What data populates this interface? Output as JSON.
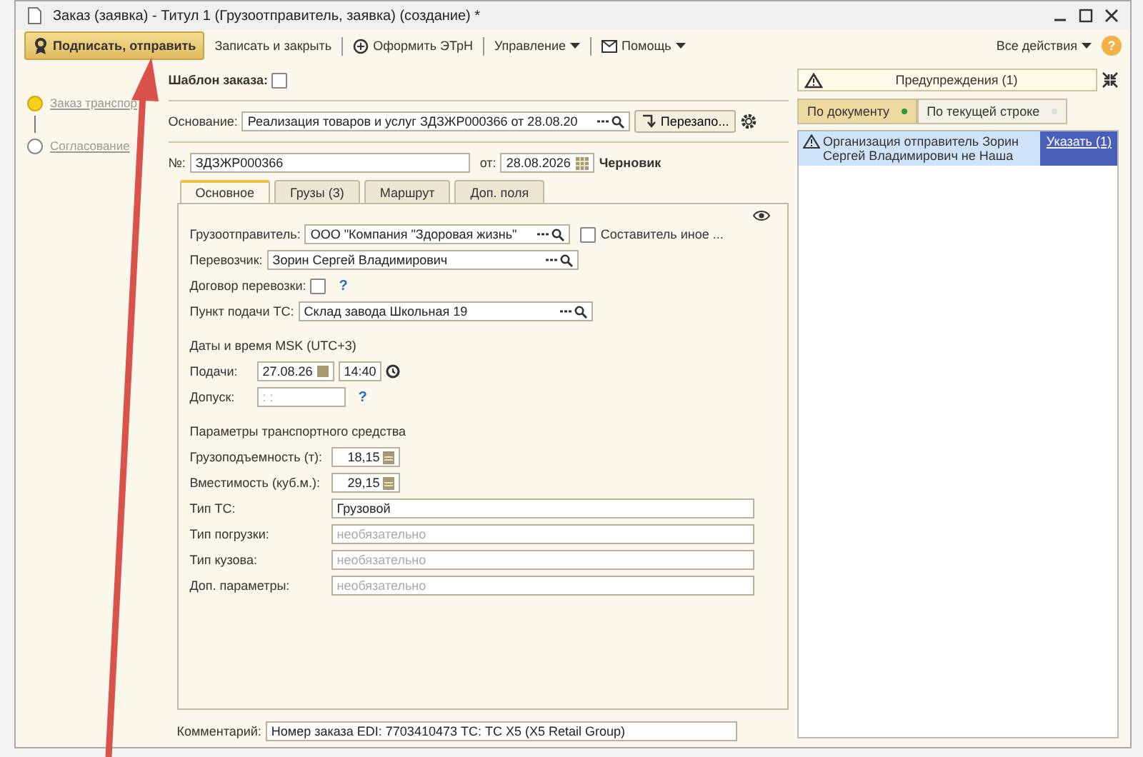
{
  "window": {
    "title": "Заказ (заявка) - Титул 1 (Грузоотправитель, заявка) (создание) *"
  },
  "toolbar": {
    "buttons": [
      {
        "label": "Подписать, отправить",
        "kind": "primary"
      },
      {
        "label": "Записать и закрыть",
        "kind": "plain"
      },
      {
        "label": "Оформить ЭТрН",
        "kind": "doc"
      },
      {
        "label": "Управление",
        "kind": "menu"
      },
      {
        "label": "Помощь",
        "kind": "mail"
      }
    ],
    "all_actions": "Все действия",
    "help": "?"
  },
  "steps": [
    {
      "label": "Заказ транспор",
      "selected": true
    },
    {
      "label": "Согласование",
      "selected": false
    }
  ],
  "form": {
    "template": {
      "label": "Шаблон заказа:",
      "checked": false
    },
    "basis": {
      "label": "Основание:",
      "value": "Реализация товаров и услуг ЗДЗЖР000366 от 28.08.20",
      "button": "Перезапо..."
    },
    "number": {
      "label": "№:",
      "value": "ЗДЗЖР000366",
      "date_label": "от:",
      "date": "28.08.2026",
      "status": "Черновик"
    },
    "tabs": [
      {
        "label": "Основное",
        "selected": true
      },
      {
        "label": "Грузы (3)",
        "selected": false
      },
      {
        "label": "Маршрут",
        "selected": false
      },
      {
        "label": "Доп. поля",
        "selected": false
      }
    ],
    "fields": [
      {
        "kind": "ref",
        "label": "Грузоотправитель:",
        "value": "ООО \"Компания \"Здоровая жизнь\"",
        "extra": {
          "label": "Составитель иное ...",
          "checked": false
        }
      },
      {
        "kind": "ref",
        "label": "Перевозчик:",
        "value": "Зорин Сергей Владимирович"
      },
      {
        "kind": "check",
        "label": "Договор перевозки:",
        "checked": false,
        "help": "?"
      },
      {
        "kind": "ref",
        "label": "Пункт подачи ТС:",
        "value": "Склад завода Школьная 19"
      },
      {
        "kind": "heading",
        "label": "Даты и время MSK (UTC+3)"
      },
      {
        "kind": "datetime",
        "label": "Подачи:",
        "date": "27.08.26",
        "time": "14:40"
      },
      {
        "kind": "mask",
        "label": "Допуск:",
        "placeholder": ": :",
        "help": "?"
      },
      {
        "kind": "heading",
        "label": "Параметры транспортного средства"
      },
      {
        "kind": "number",
        "label": "Грузоподъемность (т):",
        "value": "18,15"
      },
      {
        "kind": "number",
        "label": "Вместимость (куб.м.):",
        "value": "29,15"
      },
      {
        "kind": "text",
        "label": "Тип ТС:",
        "value": "Грузовой"
      },
      {
        "kind": "text",
        "label": "Тип погрузки:",
        "placeholder": "необязательно"
      },
      {
        "kind": "text",
        "label": "Тип кузова:",
        "placeholder": "необязательно"
      },
      {
        "kind": "text",
        "label": "Доп. параметры:",
        "placeholder": "необязательно"
      }
    ],
    "comment": {
      "label": "Комментарий:",
      "value": "Номер заказа EDI: 7703410473 ТС: ТС X5 (X5 Retail Group)"
    }
  },
  "warnings": {
    "title": "Предупреждения (1)",
    "filters": [
      {
        "label": "По документу",
        "selected": true
      },
      {
        "label": "По текущей строке",
        "selected": false
      }
    ],
    "messages": [
      {
        "text": "Организация отправитель Зорин Сергей Владимирович не Наша",
        "action": "Указать (1)"
      }
    ]
  }
}
